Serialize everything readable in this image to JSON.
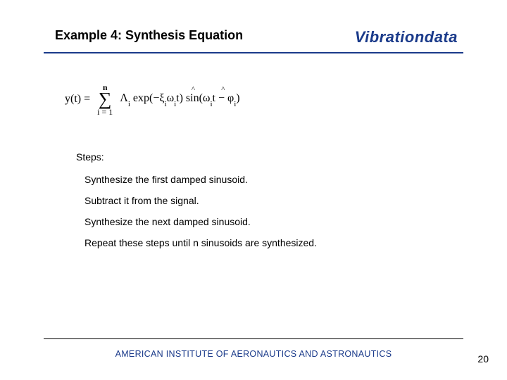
{
  "header": {
    "title": "Example 4:  Synthesis Equation",
    "brand": "Vibrationdata"
  },
  "equation": {
    "lhs": "y(t) =",
    "sum_top": "n",
    "sum_bot": "i = 1",
    "body_prefix": "Λ",
    "body_sub1": "i",
    "body_exp_open": " exp(−ξ",
    "body_sub2": "i",
    "body_omega1": "ω",
    "body_sub3": "i",
    "body_t1": " t) sin(ω",
    "body_sub4": "i",
    "body_t2": " t − φ",
    "body_sub5": "i",
    "body_close": ")"
  },
  "steps": {
    "heading": "Steps:",
    "items": [
      "Synthesize the first damped sinusoid.",
      "Subtract it from the signal.",
      "Synthesize the next damped sinusoid.",
      "Repeat these steps until n sinusoids are synthesized."
    ]
  },
  "footer": {
    "org": "AMERICAN INSTITUTE OF AERONAUTICS AND ASTRONAUTICS",
    "page": "20"
  }
}
